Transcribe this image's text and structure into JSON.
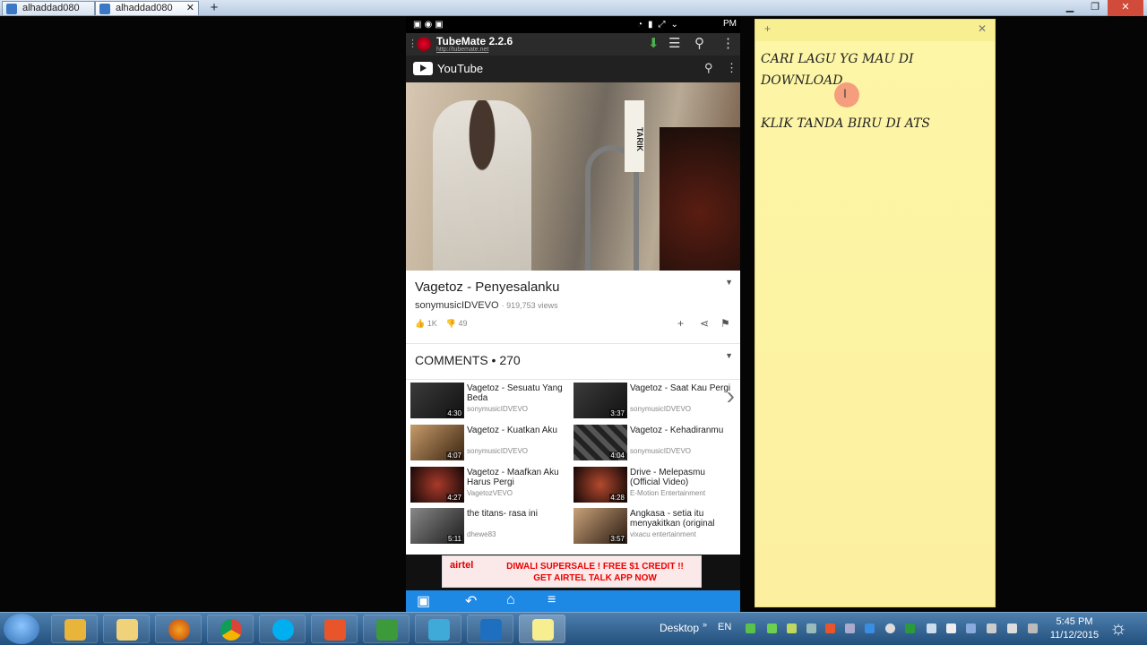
{
  "browser": {
    "tabs": [
      {
        "label": "alhaddad080"
      },
      {
        "label": "alhaddad080"
      }
    ],
    "new_tab": "+"
  },
  "phone": {
    "statusbar": {
      "time": "PM"
    },
    "tubemate": {
      "title": "TubeMate 2.2.6",
      "url": "http://tubemate.net"
    },
    "youtube": {
      "title": "YouTube"
    },
    "video": {
      "title": "Vagetoz - Penyesalanku",
      "channel": "sonymusicIDVEVO",
      "views": "· 919,753 views",
      "likes": "1K",
      "dislikes": "49",
      "sign_text": "TARIK"
    },
    "comments_header": "COMMENTS • 270",
    "related": [
      {
        "title": "Vagetoz - Sesuatu Yang Beda",
        "channel": "sonymusicIDVEVO",
        "duration": "4:30"
      },
      {
        "title": "Vagetoz - Saat Kau Pergi",
        "channel": "sonymusicIDVEVO",
        "duration": "3:37"
      },
      {
        "title": "Vagetoz - Kuatkan Aku",
        "channel": "sonymusicIDVEVO",
        "duration": "4:07"
      },
      {
        "title": "Vagetoz - Kehadiranmu",
        "channel": "sonymusicIDVEVO",
        "duration": "4:04"
      },
      {
        "title": "Vagetoz - Maafkan Aku Harus Pergi",
        "channel": "VagetozVEVO",
        "duration": "4:27"
      },
      {
        "title": "Drive - Melepasmu (Official Video)",
        "channel": "E-Motion Entertainment",
        "duration": "4:28"
      },
      {
        "title": "the titans- rasa ini",
        "channel": "dhewe83",
        "duration": "5:11"
      },
      {
        "title": "Angkasa - setia itu menyakitkan (original",
        "channel": "vixacu entertainment",
        "duration": "3:57"
      }
    ],
    "ad": {
      "brand": "airtel",
      "line1": "DIWALI SUPERSALE ! FREE $1 CREDIT !!",
      "line2": "GET AIRTEL TALK APP NOW"
    }
  },
  "note": {
    "line1": "CARI LAGU YG MAU DI DOWNLOAD",
    "line2": "KLIK TANDA BIRU DI ATS"
  },
  "taskbar": {
    "desktop_label": "Desktop",
    "lang": "EN",
    "time": "5:45 PM",
    "date": "11/12/2015"
  }
}
